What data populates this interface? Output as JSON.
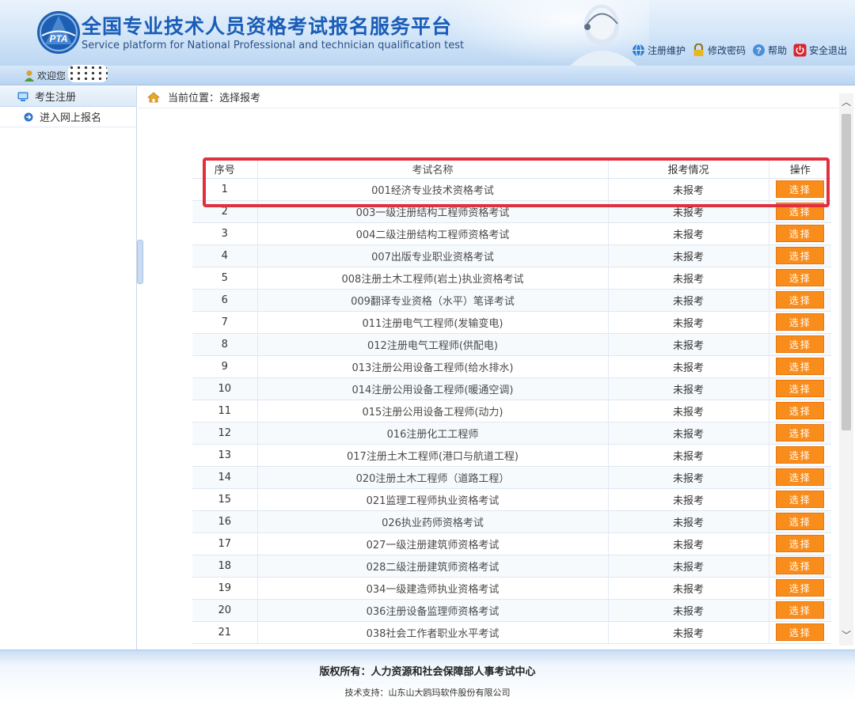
{
  "header": {
    "title": "全国专业技术人员资格考试报名服务平台",
    "subtitle": "Service platform for National Professional and technician qualification test",
    "logo_text": "PTA",
    "links": [
      {
        "label": "注册维护",
        "icon": "globe-icon"
      },
      {
        "label": "修改密码",
        "icon": "lock-icon"
      },
      {
        "label": "帮助",
        "icon": "help-icon"
      },
      {
        "label": "安全退出",
        "icon": "power-icon"
      }
    ]
  },
  "welcome": {
    "label": "欢迎您"
  },
  "sidebar": {
    "section": "考生注册",
    "items": [
      {
        "label": "进入网上报名"
      }
    ]
  },
  "breadcrumb": {
    "text": "当前位置：选择报考"
  },
  "table": {
    "headers": [
      "序号",
      "考试名称",
      "报考情况",
      "操作"
    ],
    "button_label": "选择",
    "rows": [
      {
        "no": "1",
        "name": "001经济专业技术资格考试",
        "status": "未报考"
      },
      {
        "no": "2",
        "name": "003一级注册结构工程师资格考试",
        "status": "未报考"
      },
      {
        "no": "3",
        "name": "004二级注册结构工程师资格考试",
        "status": "未报考"
      },
      {
        "no": "4",
        "name": "007出版专业职业资格考试",
        "status": "未报考"
      },
      {
        "no": "5",
        "name": "008注册土木工程师(岩土)执业资格考试",
        "status": "未报考"
      },
      {
        "no": "6",
        "name": "009翻译专业资格（水平）笔译考试",
        "status": "未报考"
      },
      {
        "no": "7",
        "name": "011注册电气工程师(发输变电)",
        "status": "未报考"
      },
      {
        "no": "8",
        "name": "012注册电气工程师(供配电)",
        "status": "未报考"
      },
      {
        "no": "9",
        "name": "013注册公用设备工程师(给水排水)",
        "status": "未报考"
      },
      {
        "no": "10",
        "name": "014注册公用设备工程师(暖通空调)",
        "status": "未报考"
      },
      {
        "no": "11",
        "name": "015注册公用设备工程师(动力)",
        "status": "未报考"
      },
      {
        "no": "12",
        "name": "016注册化工工程师",
        "status": "未报考"
      },
      {
        "no": "13",
        "name": "017注册土木工程师(港口与航道工程)",
        "status": "未报考"
      },
      {
        "no": "14",
        "name": "020注册土木工程师（道路工程）",
        "status": "未报考"
      },
      {
        "no": "15",
        "name": "021监理工程师执业资格考试",
        "status": "未报考"
      },
      {
        "no": "16",
        "name": "026执业药师资格考试",
        "status": "未报考"
      },
      {
        "no": "17",
        "name": "027一级注册建筑师资格考试",
        "status": "未报考"
      },
      {
        "no": "18",
        "name": "028二级注册建筑师资格考试",
        "status": "未报考"
      },
      {
        "no": "19",
        "name": "034一级建造师执业资格考试",
        "status": "未报考"
      },
      {
        "no": "20",
        "name": "036注册设备监理师资格考试",
        "status": "未报考"
      },
      {
        "no": "21",
        "name": "038社会工作者职业水平考试",
        "status": "未报考"
      }
    ]
  },
  "footer": {
    "copyright": "版权所有：人力资源和社会保障部人事考试中心",
    "support": "技术支持：山东山大鸥玛软件股份有限公司"
  },
  "colors": {
    "accent_orange": "#f98d1b",
    "highlight_red": "#e0303f",
    "title_blue": "#1a5db8"
  }
}
